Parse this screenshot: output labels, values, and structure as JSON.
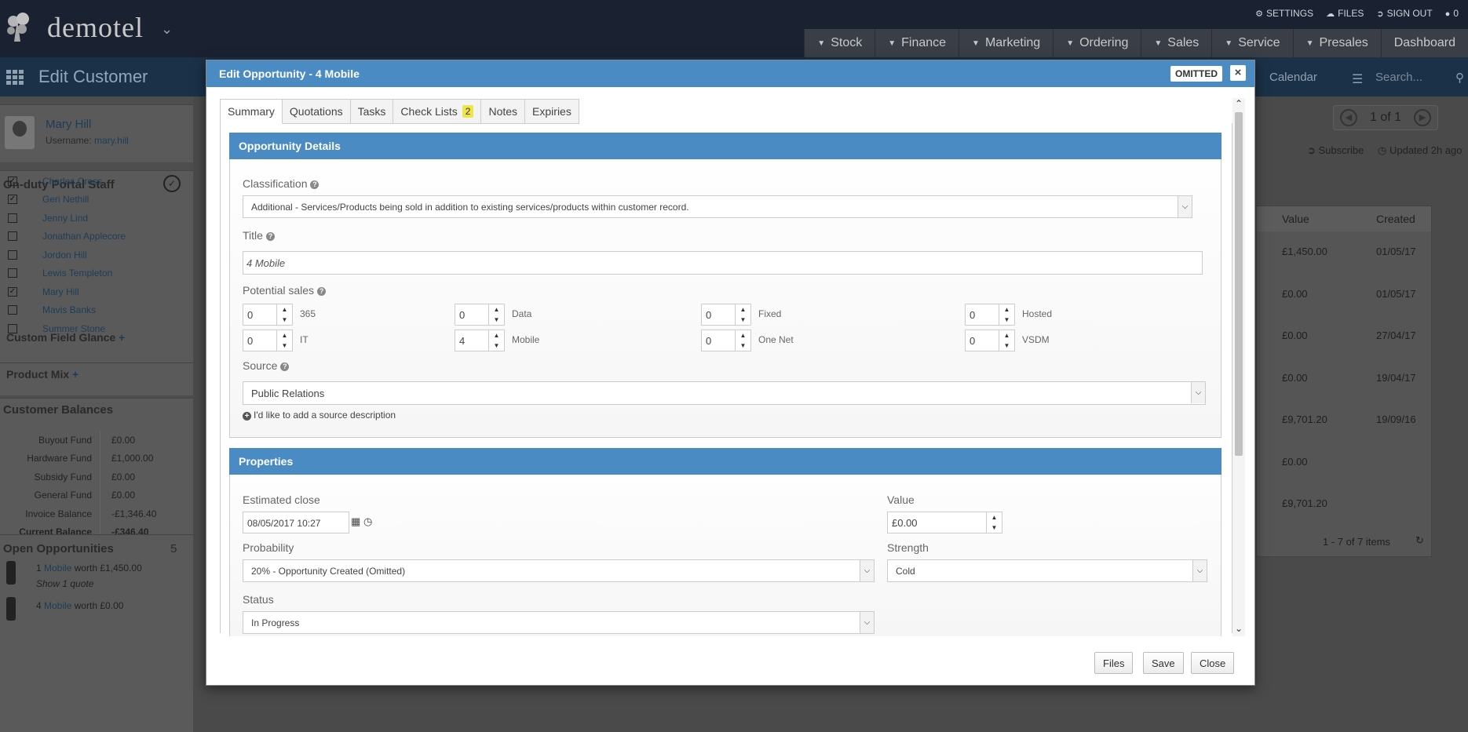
{
  "app": {
    "logo_text": "demotel",
    "util_links": [
      "SETTINGS",
      "FILES",
      "SIGN OUT",
      "0"
    ],
    "nav": [
      "Stock",
      "Finance",
      "Marketing",
      "Ordering",
      "Sales",
      "Service",
      "Presales",
      "Dashboard"
    ],
    "page_title": "Edit Customer",
    "calendar": "Calendar",
    "search_placeholder": "Search..."
  },
  "sidebar": {
    "user_name": "Mary Hill",
    "username_label": "Username: ",
    "username_value": "mary.hill",
    "staff_heading": "On-duty Portal Staff",
    "staff": [
      {
        "name": "Charles Cross",
        "checked": true
      },
      {
        "name": "Geri Nethill",
        "checked": true
      },
      {
        "name": "Jenny Lind",
        "checked": false
      },
      {
        "name": "Jonathan Applecore",
        "checked": false
      },
      {
        "name": "Jordon Hill",
        "checked": false
      },
      {
        "name": "Lewis Templeton",
        "checked": false
      },
      {
        "name": "Mary Hill",
        "checked": true
      },
      {
        "name": "Mavis Banks",
        "checked": false
      },
      {
        "name": "Summer Stone",
        "checked": false
      }
    ],
    "custom_field_glance": "Custom Field Glance",
    "product_mix": "Product Mix",
    "plus": "+",
    "balances_heading": "Customer Balances",
    "balances": [
      {
        "label": "Buyout Fund",
        "value": "£0.00"
      },
      {
        "label": "Hardware Fund",
        "value": "£1,000.00"
      },
      {
        "label": "Subsidy Fund",
        "value": "£0.00"
      },
      {
        "label": "General Fund",
        "value": "£0.00"
      },
      {
        "label": "Invoice Balance",
        "value": "-£1,346.40"
      },
      {
        "label": "Current Balance",
        "value": "-£346.40"
      }
    ],
    "opportunities_heading": "Open Opportunities",
    "opportunities_count": "5",
    "opportunities": [
      {
        "prefix": "1 ",
        "link": "Mobile",
        "suffix": " worth £1,450.00",
        "sub": "Show 1 quote"
      },
      {
        "prefix": "4 ",
        "link": "Mobile",
        "suffix": " worth £0.00",
        "sub": ""
      }
    ]
  },
  "background_page": {
    "pager": "1 of 1",
    "subscribe": "Subscribe",
    "updated": "Updated 2h ago",
    "columns": [
      "Value",
      "Created"
    ],
    "rows": [
      {
        "value": "£1,450.00",
        "created": "01/05/17"
      },
      {
        "value": "£0.00",
        "created": "01/05/17"
      },
      {
        "value": "£0.00",
        "created": "27/04/17"
      },
      {
        "value": "£0.00",
        "created": "19/04/17"
      },
      {
        "value": "£9,701.20",
        "created": "19/09/16"
      },
      {
        "value": "£0.00",
        "created": ""
      },
      {
        "value": "£9,701.20",
        "created": ""
      }
    ],
    "items_summary": "1 - 7 of 7 items"
  },
  "modal": {
    "title": "Edit Opportunity - 4 Mobile",
    "status_badge": "OMITTED",
    "tabs": [
      {
        "label": "Summary"
      },
      {
        "label": "Quotations"
      },
      {
        "label": "Tasks"
      },
      {
        "label": "Check Lists",
        "badge": "2"
      },
      {
        "label": "Notes"
      },
      {
        "label": "Expiries"
      }
    ],
    "details": {
      "heading": "Opportunity Details",
      "classification_label": "Classification",
      "classification_value": "Additional - Services/Products being sold in addition to existing services/products within customer record.",
      "title_label": "Title",
      "title_placeholder": "4 Mobile",
      "potential_sales_label": "Potential sales",
      "sales": [
        {
          "label": "365",
          "value": "0"
        },
        {
          "label": "Data",
          "value": "0"
        },
        {
          "label": "Fixed",
          "value": "0"
        },
        {
          "label": "Hosted",
          "value": "0"
        },
        {
          "label": "IT",
          "value": "0"
        },
        {
          "label": "Mobile",
          "value": "4"
        },
        {
          "label": "One Net",
          "value": "0"
        },
        {
          "label": "VSDM",
          "value": "0"
        }
      ],
      "source_label": "Source",
      "source_value": "Public Relations",
      "source_description_link": "I'd like to add a source description"
    },
    "properties": {
      "heading": "Properties",
      "estimated_close_label": "Estimated close",
      "estimated_close_value": "08/05/2017 10:27",
      "value_label": "Value",
      "value_value": "£0.00",
      "probability_label": "Probability",
      "probability_value": "20% - Opportunity Created (Omitted)",
      "strength_label": "Strength",
      "strength_value": "Cold",
      "status_label": "Status",
      "status_value": "In Progress"
    },
    "buttons": {
      "files": "Files",
      "save": "Save",
      "close": "Close"
    }
  },
  "colors": {
    "topbar": "#1a2232",
    "subheader": "#1b3147",
    "modal_header": "#4a8bc4",
    "badge_yellow": "#f0e44a"
  }
}
